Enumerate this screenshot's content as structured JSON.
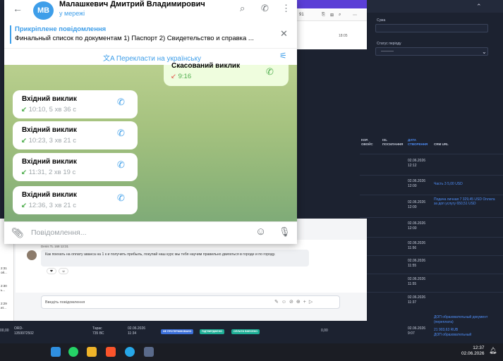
{
  "telegram": {
    "contact_initials": "MB",
    "contact_name": "Малашкевич Дмитрий Владимирович",
    "contact_status": "у мережі",
    "pinned_title": "Прикріплене повідомлення",
    "pinned_text": "Финальный список по документам  1) Паспорт 2) Свидетельство и справка ...",
    "translate_label": "Перекласти на українську",
    "outgoing_call": {
      "title": "Скасований виклик",
      "time": "9:16"
    },
    "calls": [
      {
        "title": "Вхідний виклик",
        "meta": "10:10, 5 хв 36 с"
      },
      {
        "title": "Вхідний виклик",
        "meta": "10:23, 3 хв 21 с"
      },
      {
        "title": "Вхідний виклик",
        "meta": "11:31, 2 хв 19 с"
      },
      {
        "title": "Вхідний виклик",
        "meta": "12:36, 3 хв 21 с"
      }
    ],
    "composer_placeholder": "Повідомлення..."
  },
  "crm": {
    "sum_label": "Сума",
    "period_label": "Статус періоду",
    "period_value": "---------",
    "headers": [
      "КОР. ОВОЙС",
      "ISL ПОСИЛАННЯ",
      "ДАТА СТВОРЕННЯ",
      "CRM URL"
    ],
    "rows": [
      {
        "date": "02.06.2026",
        "time": "12:12",
        "link": ""
      },
      {
        "date": "02.06.2026",
        "time": "12:00",
        "link": "Часть 3 5,00 USD"
      },
      {
        "date": "02.06.2026",
        "time": "12:00",
        "link": "Подача личная 7 329,45 USD Оплата за доп услугу 650,51 USD"
      },
      {
        "date": "02.06.2026",
        "time": "12:00",
        "link": ""
      },
      {
        "date": "02.06.2026",
        "time": "11:56",
        "link": ""
      },
      {
        "date": "02.06.2026",
        "time": "11:55",
        "link": ""
      },
      {
        "date": "02.06.2026",
        "time": "11:55",
        "link": ""
      },
      {
        "date": "02.06.2026",
        "time": "11:37",
        "link": ""
      }
    ],
    "bottom": {
      "amount": "00,00",
      "order": "ORD-",
      "order_id": "1359972502",
      "person": "Тарас",
      "person_sub": "735 ВС",
      "date": "02.06.2026",
      "time": "11:34",
      "badge1": "НЕ ПРОТЕРМІНОВАНО",
      "badge2": "ПІДТВЕРДЖЕНО",
      "badge3": "ОПЛАТИ ВНЕСЕНО",
      "value": "0,00",
      "right_date": "02.06.2026",
      "right_time": "9:07",
      "right_link1": "ДОП образовательный документ (переплата)",
      "right_link2": "21 903,63 RUB",
      "right_link3": "ДОП образовательный"
    }
  },
  "browser": {
    "counter": "91",
    "time": "18:05"
  },
  "team_chat": {
    "author": "Denis TL 168  12:31",
    "message": "Как поехать на оплату аванса на 1 к и получить прибыль, покупай наш курс мы тебя научим правильно двигаться в городе и по городу.",
    "input_placeholder": "Введіть повідомлення",
    "side_items": [
      "2:31",
      "ой...",
      "2:30",
      "ь...",
      "2:29",
      "ит..."
    ]
  },
  "taskbar": {
    "time": "12:37",
    "date": "02.06.2026"
  },
  "colors": {
    "tg_accent": "#3e9ee9",
    "crm_bg": "#1c2230",
    "link": "#4f8ef7"
  }
}
